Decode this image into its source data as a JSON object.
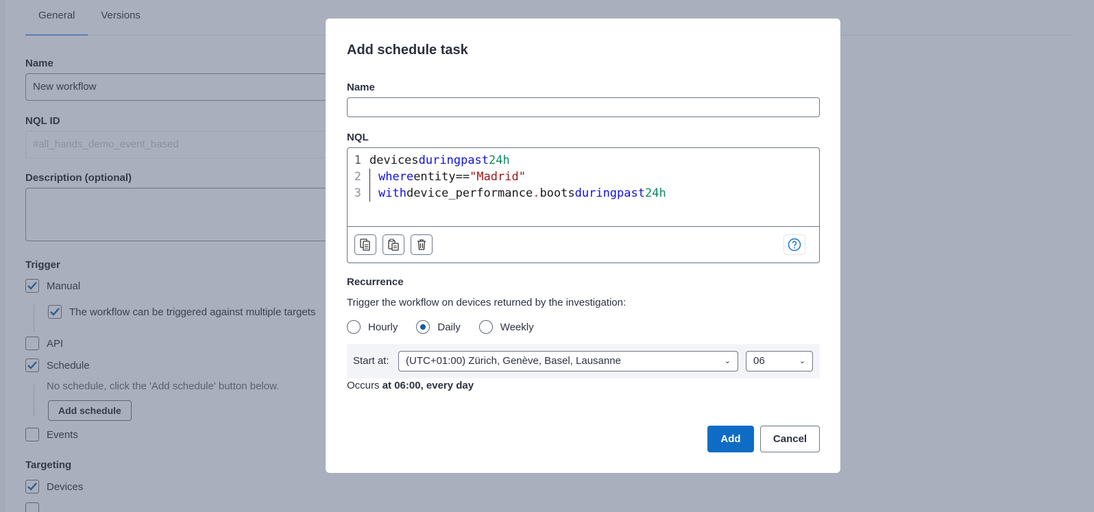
{
  "page": {
    "tabs": [
      {
        "label": "General",
        "active": true
      },
      {
        "label": "Versions",
        "active": false
      }
    ],
    "name_label": "Name",
    "name_value": "New workflow",
    "nql_id_label": "NQL ID",
    "nql_id_value": "#all_hands_demo_event_based",
    "description_label": "Description (optional)",
    "trigger_label": "Trigger",
    "manual": "Manual",
    "multi_targets": "The workflow can be triggered against multiple targets",
    "api": "API",
    "schedule": "Schedule",
    "no_schedule": "No schedule, click the 'Add schedule' button below.",
    "add_schedule": "Add schedule",
    "events": "Events",
    "targeting_label": "Targeting",
    "devices": "Devices"
  },
  "modal": {
    "title": "Add schedule task",
    "name_label": "Name",
    "name_value": "",
    "nql_label": "NQL",
    "code": {
      "l1": {
        "n": "1",
        "a": "devices",
        "b": "during",
        "c": "past",
        "d": "24h"
      },
      "l2": {
        "n": "2",
        "a": "where",
        "b": "entity",
        "c": "==",
        "d": "\"Madrid\""
      },
      "l3": {
        "n": "3",
        "a": "with",
        "b": "device_performance",
        "c": ".",
        "d": "boots",
        "e": "during",
        "f": "past",
        "g": "24h"
      }
    },
    "recurrence_label": "Recurrence",
    "recurrence_text": "Trigger the workflow on devices returned by the investigation:",
    "options": [
      "Hourly",
      "Daily",
      "Weekly"
    ],
    "selected": "Daily",
    "start_at_label": "Start at:",
    "timezone": "(UTC+01:00) Zürich, Genève, Basel, Lausanne",
    "hour": "06",
    "occurs_prefix": "Occurs",
    "occurs_value": "at 06:00, every day",
    "add": "Add",
    "cancel": "Cancel"
  },
  "colors": {
    "primary": "#0f6cc4",
    "overlay": "#a9afbc"
  }
}
